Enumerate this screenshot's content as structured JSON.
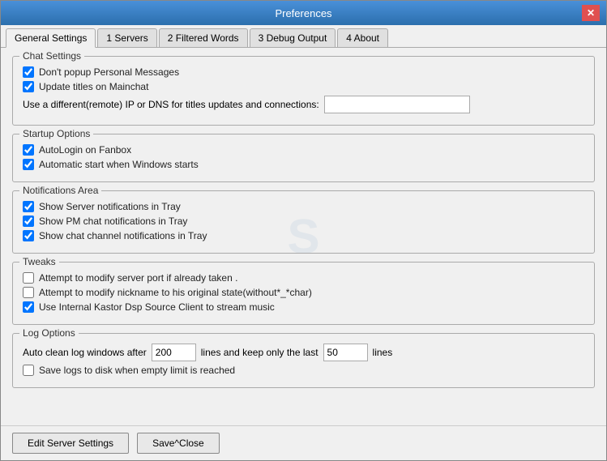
{
  "window": {
    "title": "Preferences",
    "close_label": "✕"
  },
  "tabs": [
    {
      "id": "general",
      "label": "General Settings",
      "active": true
    },
    {
      "id": "servers",
      "label": "1 Servers"
    },
    {
      "id": "filtered",
      "label": "2 Filtered Words"
    },
    {
      "id": "debug",
      "label": "3 Debug Output"
    },
    {
      "id": "about",
      "label": "4 About"
    }
  ],
  "chat_settings": {
    "group_label": "Chat Settings",
    "dont_popup": {
      "checked": true,
      "label": "Don't popup Personal Messages"
    },
    "update_titles": {
      "checked": true,
      "label": "Update titles on Mainchat"
    },
    "ip_dns_label": "Use a different(remote) IP or DNS  for titles updates and connections:",
    "ip_dns_value": ""
  },
  "startup_options": {
    "group_label": "Startup Options",
    "autologin": {
      "checked": true,
      "label": "AutoLogin on Fanbox"
    },
    "auto_start": {
      "checked": true,
      "label": "Automatic start when Windows starts"
    }
  },
  "notifications_area": {
    "group_label": "Notifications Area",
    "show_server": {
      "checked": true,
      "label": "Show Server notifications in Tray"
    },
    "show_pm": {
      "checked": true,
      "label": "Show PM chat notifications in Tray"
    },
    "show_channel": {
      "checked": true,
      "label": "Show chat channel notifications in Tray"
    }
  },
  "tweaks": {
    "group_label": "Tweaks",
    "modify_port": {
      "checked": false,
      "label": "Attempt to modify server  port if already taken ."
    },
    "modify_nickname": {
      "checked": false,
      "label": "Attempt to modify nickname to his original  state(without*_*char)"
    },
    "use_kastor": {
      "checked": true,
      "label": "Use Internal Kastor Dsp Source Client to stream music"
    }
  },
  "log_options": {
    "group_label": "Log Options",
    "auto_clean_prefix": "Auto clean log windows after",
    "lines_value": "200",
    "lines_middle": "lines  and keep only the last",
    "keep_value": "50",
    "lines_suffix": "lines",
    "save_logs": {
      "checked": false,
      "label": "Save logs to disk when empty limit is reached"
    }
  },
  "footer": {
    "edit_server": "Edit Server Settings",
    "save_close": "Save^Close"
  },
  "watermark": "S"
}
